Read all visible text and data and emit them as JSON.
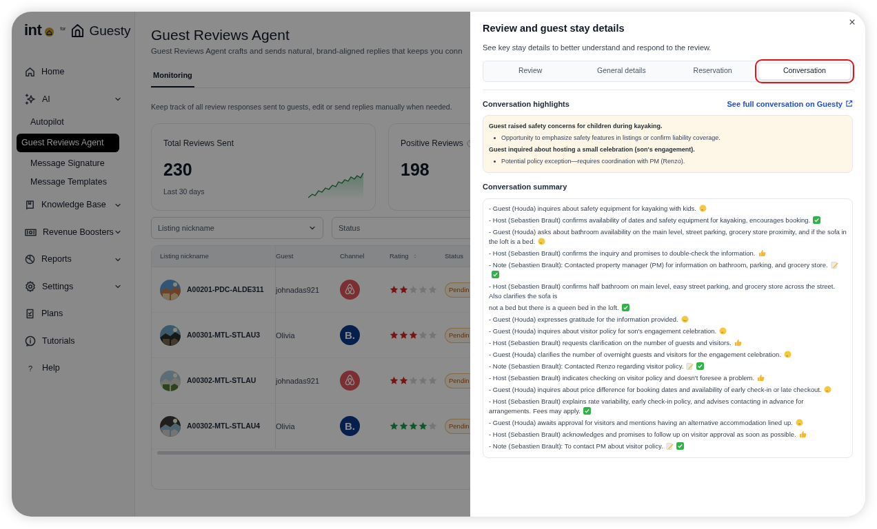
{
  "logo": {
    "brand": "int",
    "connector": "for",
    "partner": "Guesty"
  },
  "sidebar": {
    "items": [
      {
        "label": "Home",
        "selected": false
      },
      {
        "label": "AI",
        "selected": false,
        "submenu": true,
        "children": [
          {
            "label": "Autopilot",
            "selected": false
          },
          {
            "label": "Guest Reviews Agent",
            "selected": true
          },
          {
            "label": "Message Signature",
            "selected": false
          },
          {
            "label": "Message Templates",
            "selected": false
          }
        ]
      },
      {
        "label": "Knowledge Base",
        "selected": false,
        "submenu": true
      },
      {
        "label": "Revenue Boosters",
        "selected": false,
        "submenu": true
      },
      {
        "label": "Reports",
        "selected": false,
        "submenu": true
      },
      {
        "label": "Settings",
        "selected": false,
        "submenu": true
      },
      {
        "label": "Plans",
        "selected": false
      },
      {
        "label": "Tutorials",
        "selected": false
      },
      {
        "label": "Help",
        "selected": false,
        "icon_char": "?"
      }
    ]
  },
  "page": {
    "title": "Guest Reviews Agent",
    "subtitle": "Guest Reviews Agent crafts and sends natural, brand-aligned replies that keeps you conn",
    "tabs": [
      {
        "label": "Monitoring",
        "selected": true
      }
    ],
    "intro": "Keep track of all review responses sent to guests, edit or send replies manually when needed.",
    "cards": [
      {
        "title": "Total Reviews Sent",
        "value": "230",
        "caption": "Last 30 days",
        "sparkline": true
      },
      {
        "title": "Positive Reviews",
        "value": "198",
        "help": true
      }
    ],
    "filters": [
      {
        "placeholder": "Listing nickname"
      },
      {
        "placeholder": "Status"
      }
    ],
    "table": {
      "columns": [
        "Listing nickname",
        "Guest",
        "Channel",
        "Rating",
        "Status"
      ],
      "rows": [
        {
          "listing": "A00201-PDC-ALDE311",
          "guest": "johnadas921",
          "channel": {
            "kind": "airbnb"
          },
          "stars": 2,
          "status": "Pendin"
        },
        {
          "listing": "A00301-MTL-STLAU3",
          "guest": "Olivia",
          "channel": {
            "kind": "booking",
            "label": "B."
          },
          "stars": 3,
          "status": "Pendin"
        },
        {
          "listing": "A00302-MTL-STLAU",
          "guest": "johnadas921",
          "channel": {
            "kind": "airbnb"
          },
          "stars": 2,
          "status": "Pendin"
        },
        {
          "listing": "A00302-MTL-STLAU4",
          "guest": "Olivia",
          "channel": {
            "kind": "booking",
            "label": "B."
          },
          "stars": 4,
          "status": "Pendin"
        }
      ]
    }
  },
  "drawer": {
    "title": "Review and guest stay details",
    "description": "See key stay details to better understand and respond to the review.",
    "tabs": [
      {
        "label": "Review",
        "selected": false,
        "outlined": false
      },
      {
        "label": "General details",
        "selected": false,
        "outlined": false
      },
      {
        "label": "Reservation",
        "selected": false,
        "outlined": false
      },
      {
        "label": "Conversation",
        "selected": true,
        "outlined": true
      }
    ],
    "highlights": {
      "title": "Conversation highlights",
      "link": "See full conversation on Guesty",
      "items": [
        {
          "kind": "heading",
          "text": "Guest raised safety concerns for children during kayaking."
        },
        {
          "kind": "bullet",
          "text": "Opportunity to emphasize safety features in listings or confirm liability coverage."
        },
        {
          "kind": "heading",
          "text": "Guest inquired about hosting a small celebration (son's engagement)."
        },
        {
          "kind": "bullet",
          "text": "Potential policy exception—requires coordination with PM (Renzo)."
        }
      ]
    },
    "summary": {
      "title": "Conversation summary",
      "lines": [
        {
          "text": "- Guest (Houda) inquires about safety equipment for kayaking with kids.",
          "reactions": [
            {
              "kind": "thinking"
            }
          ]
        },
        {
          "text": "- Host (Sebastien Brault) confirms availability of dates and safety equipment for kayaking, encourages booking.",
          "reactions": [
            {
              "kind": "check"
            }
          ]
        },
        {
          "text": "- Guest (Houda) asks about bathroom availability on the main level, street parking, grocery store proximity, and if the sofa in the loft is a bed.",
          "reactions": [
            {
              "kind": "thinking"
            }
          ]
        },
        {
          "text": "- Host (Sebastien Brault) confirms the inquiry and promises to double-check the information.",
          "reactions": [
            {
              "kind": "thumbs-up"
            }
          ]
        },
        {
          "text": "- Note (Sebastien Brault): Contacted property manager (PM) for information on bathroom, parking, and grocery store.",
          "reactions": [
            {
              "kind": "memo"
            },
            {
              "kind": "check"
            }
          ]
        },
        {
          "text": "- Host (Sebastien Brault) confirms half bathroom on main level, easy street parking, and grocery store across the street. Also clarifies the sofa is"
        },
        {
          "text": "not a bed but there is a queen bed in the loft.",
          "reactions": [
            {
              "kind": "check"
            }
          ]
        },
        {
          "text": "- Guest (Houda) expresses gratitude for the information provided.",
          "reactions": [
            {
              "kind": "smile"
            }
          ]
        },
        {
          "text": "- Guest (Houda) inquires about visitor policy for son's engagement celebration.",
          "reactions": [
            {
              "kind": "thinking"
            }
          ]
        },
        {
          "text": "- Host (Sebastien Brault) requests clarification on the number of guests and visitors.",
          "reactions": [
            {
              "kind": "thumbs-up"
            }
          ]
        },
        {
          "text": "- Guest (Houda) clarifies the number of overnight guests and visitors for the engagement celebration.",
          "reactions": [
            {
              "kind": "thinking"
            }
          ]
        },
        {
          "text": "- Note (Sebastien Brault): Contacted Renzo regarding visitor policy.",
          "reactions": [
            {
              "kind": "memo"
            },
            {
              "kind": "check"
            }
          ]
        },
        {
          "text": "- Host (Sebastien Brault) indicates checking on visitor policy and doesn't foresee a problem.",
          "reactions": [
            {
              "kind": "thumbs-up"
            }
          ]
        },
        {
          "text": "- Guest (Houda) inquires about price difference for booking dates and availability of early check-in or late checkout.",
          "reactions": [
            {
              "kind": "thinking"
            }
          ]
        },
        {
          "text": "- Host (Sebastien Brault) explains rate variability, early check-in policy, and advises contacting in advance for arrangements. Fees may apply.",
          "reactions": [
            {
              "kind": "check"
            }
          ]
        },
        {
          "text": "- Guest (Houda) awaits approval for visitors and mentions having an alternative accommodation lined up.",
          "reactions": [
            {
              "kind": "relieved"
            }
          ]
        },
        {
          "text": "- Host (Sebastien Brault) acknowledges and promises to follow up on visitor approval as soon as possible.",
          "reactions": [
            {
              "kind": "thumbs-up"
            }
          ]
        },
        {
          "text": "- Note (Sebastien Brault): To contact PM about visitor policy.",
          "reactions": [
            {
              "kind": "memo"
            },
            {
              "kind": "check"
            }
          ]
        }
      ]
    }
  }
}
